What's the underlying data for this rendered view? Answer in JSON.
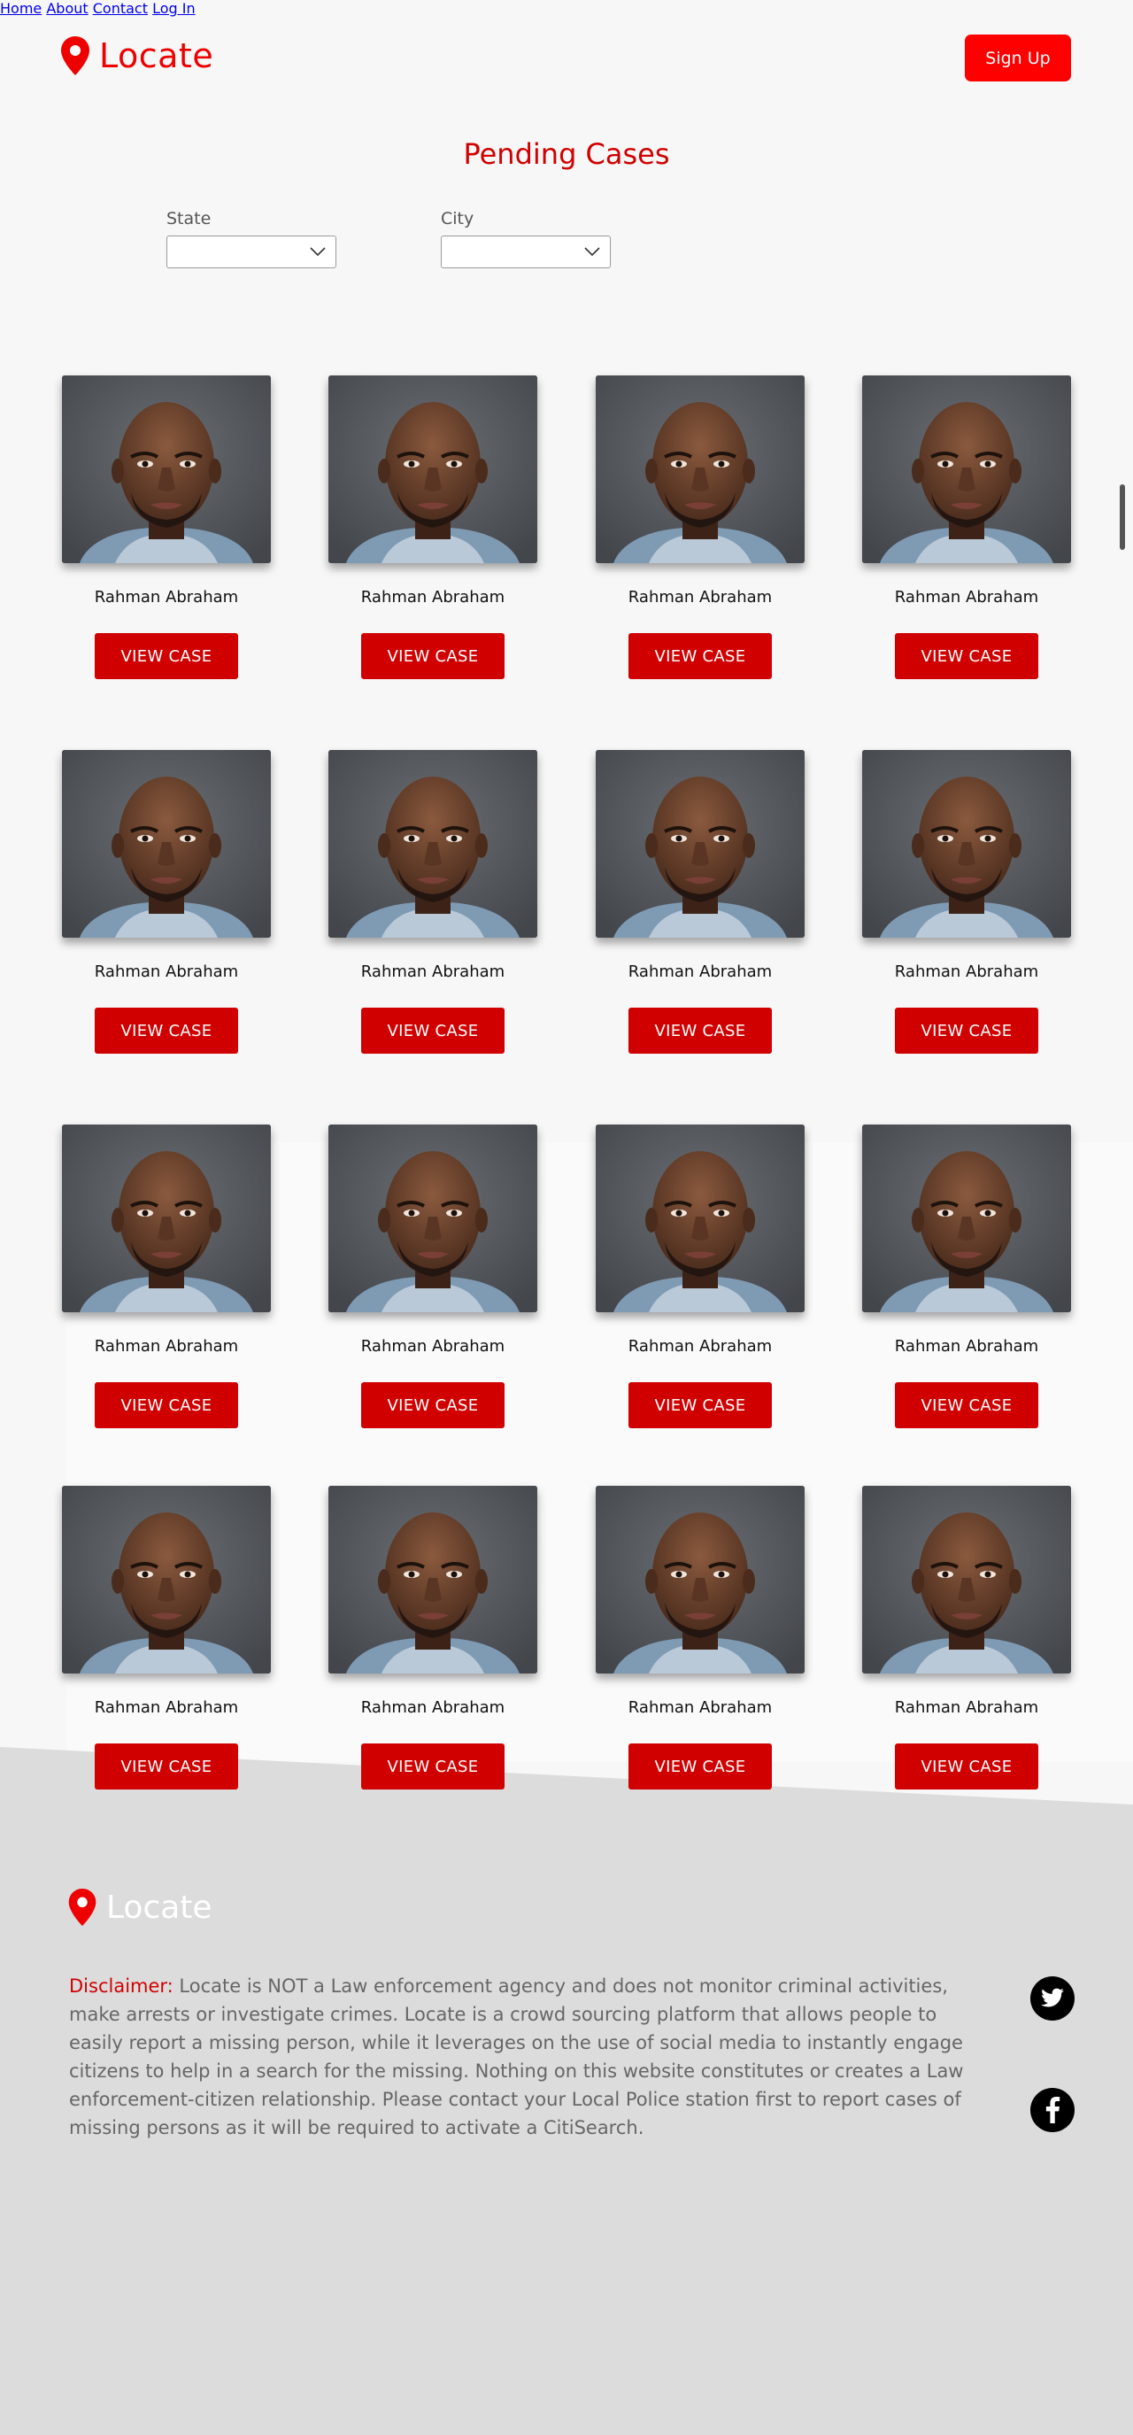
{
  "header": {
    "brand": "Locate",
    "nav": [
      "Home",
      "About",
      "Contact",
      "Log In"
    ],
    "signup": "Sign Up"
  },
  "title": "Pending Cases",
  "filters": {
    "state_label": "State",
    "city_label": "City",
    "state_value": "",
    "city_value": ""
  },
  "cases": [
    {
      "name": "Rahman Abraham",
      "button": "VIEW CASE"
    },
    {
      "name": "Rahman Abraham",
      "button": "VIEW CASE"
    },
    {
      "name": "Rahman Abraham",
      "button": "VIEW CASE"
    },
    {
      "name": "Rahman Abraham",
      "button": "VIEW CASE"
    },
    {
      "name": "Rahman Abraham",
      "button": "VIEW CASE"
    },
    {
      "name": "Rahman Abraham",
      "button": "VIEW CASE"
    },
    {
      "name": "Rahman Abraham",
      "button": "VIEW CASE"
    },
    {
      "name": "Rahman Abraham",
      "button": "VIEW CASE"
    },
    {
      "name": "Rahman Abraham",
      "button": "VIEW CASE"
    },
    {
      "name": "Rahman Abraham",
      "button": "VIEW CASE"
    },
    {
      "name": "Rahman Abraham",
      "button": "VIEW CASE"
    },
    {
      "name": "Rahman Abraham",
      "button": "VIEW CASE"
    },
    {
      "name": "Rahman Abraham",
      "button": "VIEW CASE"
    },
    {
      "name": "Rahman Abraham",
      "button": "VIEW CASE"
    },
    {
      "name": "Rahman Abraham",
      "button": "VIEW CASE"
    },
    {
      "name": "Rahman Abraham",
      "button": "VIEW CASE"
    }
  ],
  "footer": {
    "brand": "Locate",
    "disclaimer_label": "Disclaimer:",
    "disclaimer_text": " Locate is NOT a Law enforcement agency and does not monitor criminal activities, make arrests or investigate crimes. Locate is a crowd sourcing platform that allows people to easily report a missing person, while it leverages on the use of social media to instantly engage citizens to help in a search for the missing. Nothing on this website constitutes or creates a Law enforcement-citizen relationship. Please contact your Local Police station first to report cases of missing persons as it will be required to activate a CitiSearch.",
    "social": [
      "twitter-icon",
      "facebook-icon"
    ]
  },
  "colors": {
    "brand_red": "#e00000",
    "button_red": "#d10000",
    "footer_bg": "#dcdcdc"
  }
}
